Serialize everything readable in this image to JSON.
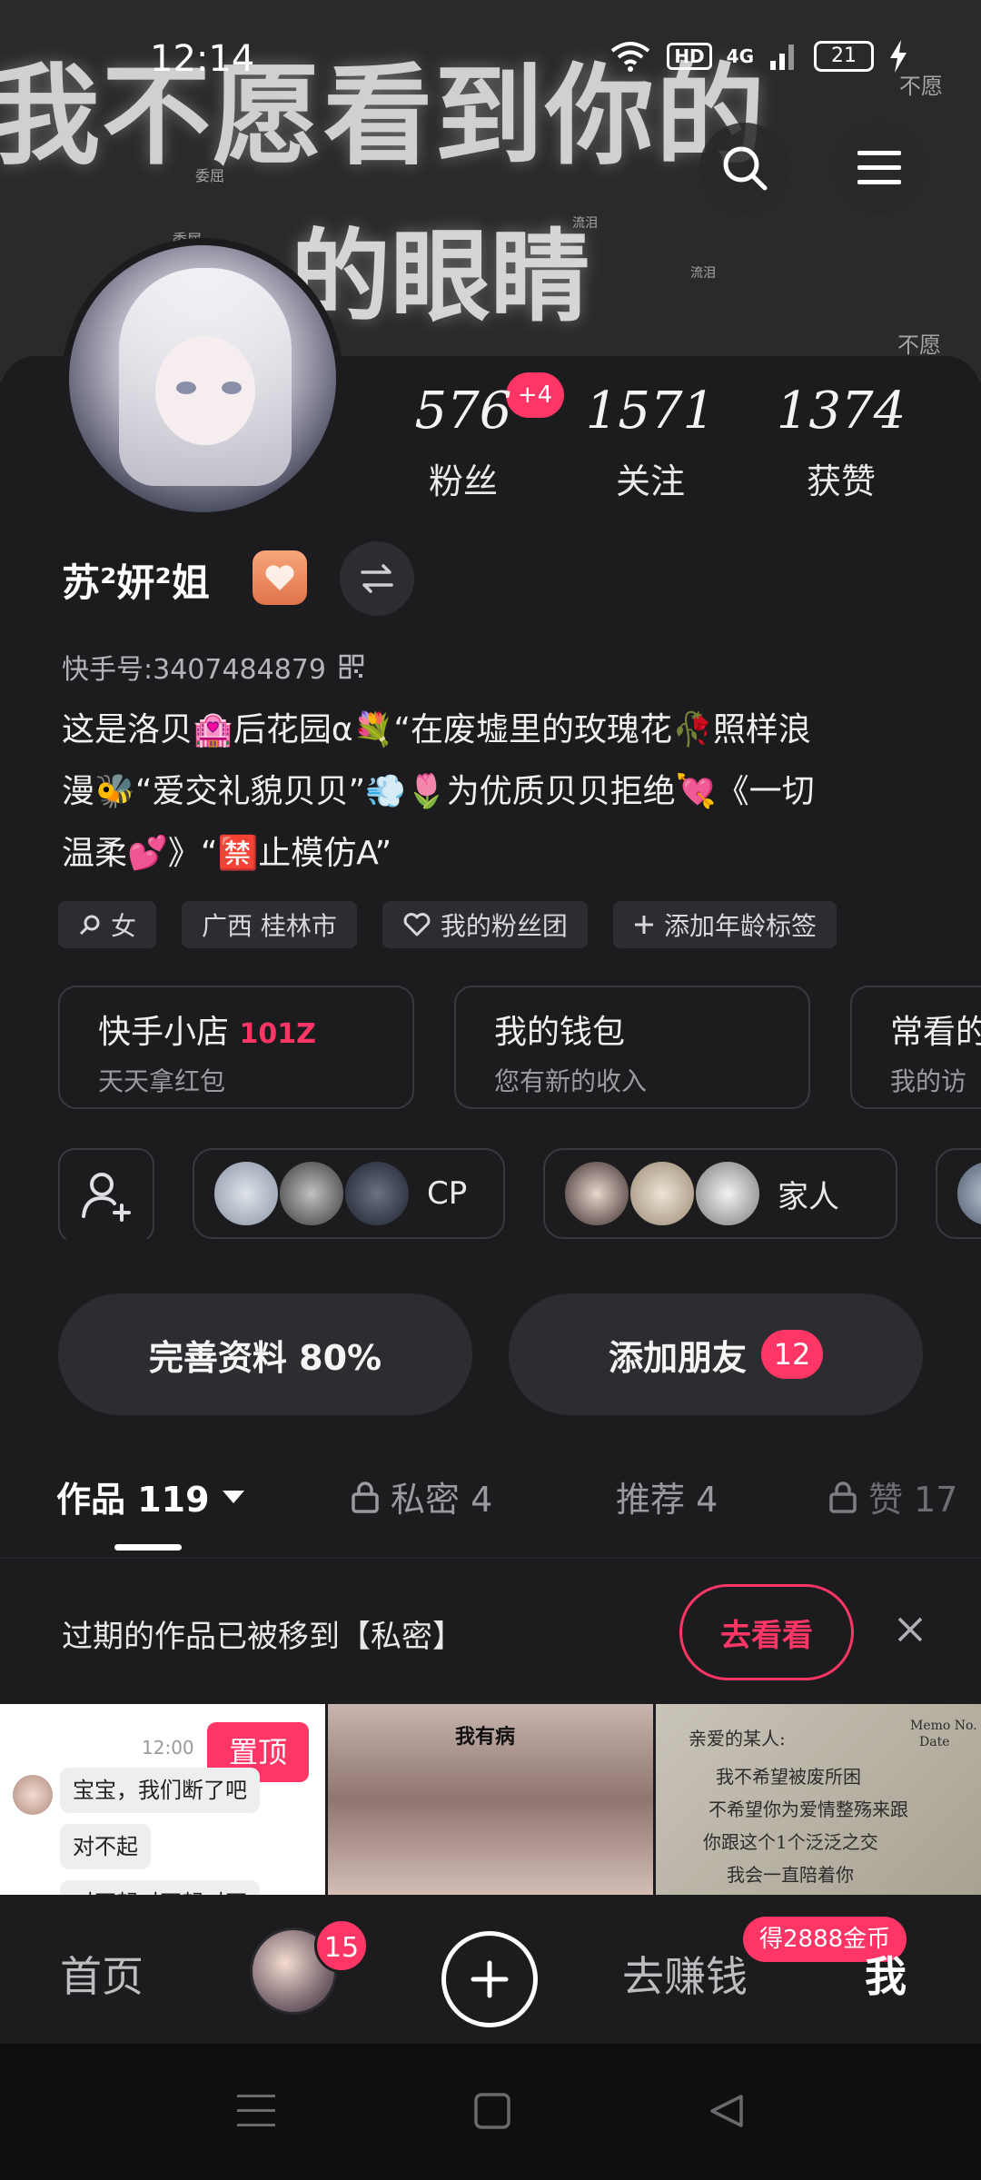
{
  "status_bar": {
    "time": "12:14",
    "network_label": "HD",
    "signal_label": "4G",
    "battery": "21"
  },
  "banner": {
    "line1": "我不愿看到你的",
    "line2": "的眼睛",
    "small_words": [
      "不愿",
      "委屈",
      "委屈",
      "流泪",
      "流泪",
      "不愿"
    ]
  },
  "profile": {
    "stats": [
      {
        "value": "576",
        "label": "粉丝"
      },
      {
        "value": "1571",
        "label": "关注"
      },
      {
        "value": "1374",
        "label": "获赞"
      }
    ],
    "fans_new_badge": "+4",
    "nickname": "苏²妍²姐",
    "kuaishou_id": "快手号:3407484879",
    "bio_lines": [
      "这是洛贝🏩后花园α💐“在废墟里的玫瑰花🥀照样浪",
      "漫🐝“爱交礼貌贝贝”💨🌷为优质贝贝拒绝💘《一切",
      "温柔💕》“🈲止模仿A”"
    ],
    "tags": [
      {
        "icon": "female-icon",
        "label": "女"
      },
      {
        "icon": "",
        "label": "广西 桂林市"
      },
      {
        "icon": "heart-icon",
        "label": "我的粉丝团"
      },
      {
        "icon": "plus-icon",
        "label": "添加年龄标签"
      }
    ]
  },
  "cards": [
    {
      "title": "快手小店",
      "highlight": "101Z",
      "subtitle": "天天拿红包"
    },
    {
      "title": "我的钱包",
      "highlight": "",
      "subtitle": "您有新的收入"
    },
    {
      "title": "常看的",
      "highlight": "",
      "subtitle": "我的访"
    }
  ],
  "groups": [
    {
      "label": "CP"
    },
    {
      "label": "家人"
    }
  ],
  "actions": {
    "complete_profile": "完善资料 80%",
    "add_friends": "添加朋友",
    "add_friends_count": "12"
  },
  "tabs": {
    "works": "作品 119",
    "private": "私密 4",
    "recommended": "推荐 4",
    "likes": "赞 17"
  },
  "notice": {
    "text": "过期的作品已被移到【私密】",
    "button": "去看看"
  },
  "thumbnails": {
    "chat_time": "12:00",
    "pin_label": "置顶",
    "chat_lines": [
      "宝宝，我们断了吧",
      "对不起",
      "对不起对不起对不"
    ],
    "thumb2_caption": "我有病",
    "thumb3_lines": [
      "亲爱的某人:",
      "我不希望被废所困",
      "不希望你为爱情整殇来跟",
      "你跟这个1个泛泛之交",
      "我会一直陪着你",
      "Memo No.",
      "Date"
    ]
  },
  "bottom_nav": {
    "home": "首页",
    "avatar_badge": "15",
    "earn": "去赚钱",
    "coin_badge": "得2888金币",
    "me": "我"
  },
  "colors": {
    "accent": "#fe3666",
    "background": "#1c1c1f",
    "surface": "#2d2d31"
  }
}
